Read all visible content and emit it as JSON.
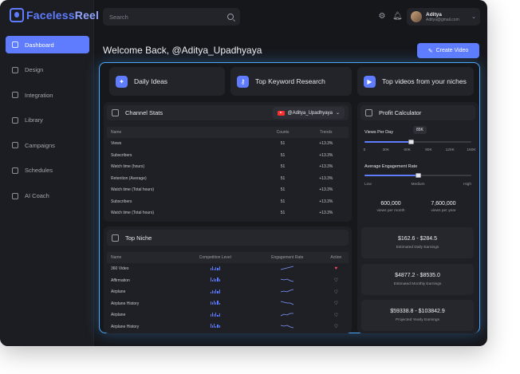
{
  "brand": {
    "name_a": "Faceless",
    "name_b": "Reel"
  },
  "sidebar": {
    "items": [
      {
        "label": "Dashboard",
        "icon": "grid-icon",
        "active": true
      },
      {
        "label": "Design",
        "icon": "brush-icon"
      },
      {
        "label": "Integration",
        "icon": "plug-icon"
      },
      {
        "label": "Library",
        "icon": "book-icon"
      },
      {
        "label": "Campaigns",
        "icon": "megaphone-icon"
      },
      {
        "label": "Schedules",
        "icon": "calendar-icon"
      },
      {
        "label": "AI Coach",
        "icon": "sparkle-icon"
      }
    ]
  },
  "topbar": {
    "search_placeholder": "Search",
    "user": {
      "name": "Aditya",
      "email": "Aditya@gmail.com"
    }
  },
  "welcome": "Welcome Back, @Aditya_Upadhyaya",
  "create_button": "Create Video",
  "features": [
    {
      "label": "Daily Ideas",
      "icon": "lightbulb-icon"
    },
    {
      "label": "Top Keyword Research",
      "icon": "key-icon"
    },
    {
      "label": "Top videos from your niches",
      "icon": "video-icon"
    }
  ],
  "channel_stats": {
    "title": "Channel Stats",
    "channel": "@Aditya_Upadhyaya",
    "columns": [
      "Name",
      "Counts",
      "Trends"
    ],
    "rows": [
      [
        "Views",
        "51",
        "+13.3%"
      ],
      [
        "Subscribers",
        "51",
        "+13.3%"
      ],
      [
        "Watch time (hours)",
        "51",
        "+13.3%"
      ],
      [
        "Retention (Average)",
        "51",
        "+13.3%"
      ],
      [
        "Watch time (Total hours)",
        "51",
        "+13.3%"
      ],
      [
        "Subscribers",
        "51",
        "+13.3%"
      ],
      [
        "Watch time (Total hours)",
        "51",
        "+13.3%"
      ]
    ]
  },
  "top_niche": {
    "title": "Top Niche",
    "columns": [
      "Name",
      "Competition Level",
      "Engagement Rate",
      "Action"
    ],
    "rows": [
      {
        "name": "360 Video",
        "liked": true
      },
      {
        "name": "Affirmation",
        "liked": false
      },
      {
        "name": "Airplane",
        "liked": false
      },
      {
        "name": "Airplane History",
        "liked": false
      },
      {
        "name": "Airplane",
        "liked": false
      },
      {
        "name": "Airplane History",
        "liked": false
      }
    ]
  },
  "profit_calculator": {
    "title": "Profit Calculator",
    "views_label": "Views Per Day",
    "views_value": "85K",
    "views_fraction": 0.44,
    "views_ticks": [
      "0",
      "30K",
      "60K",
      "90K",
      "120K",
      "150K"
    ],
    "engagement_label": "Average Engagement Rate",
    "engagement_fraction": 0.5,
    "engagement_ticks": [
      "Low",
      "Medium",
      "High"
    ],
    "views_per_month": "600,000",
    "views_per_month_label": "views per month",
    "views_per_year": "7,600,000",
    "views_per_year_label": "views per year",
    "earnings": [
      {
        "value": "$162.6 - $284.5",
        "label": "Estimated Daily Earnings"
      },
      {
        "value": "$4877.2 - $8535.0",
        "label": "Estimated Monthly Earnings"
      },
      {
        "value": "$59338.8 - $103842.9",
        "label": "Projected Yearly Earnings"
      }
    ]
  }
}
